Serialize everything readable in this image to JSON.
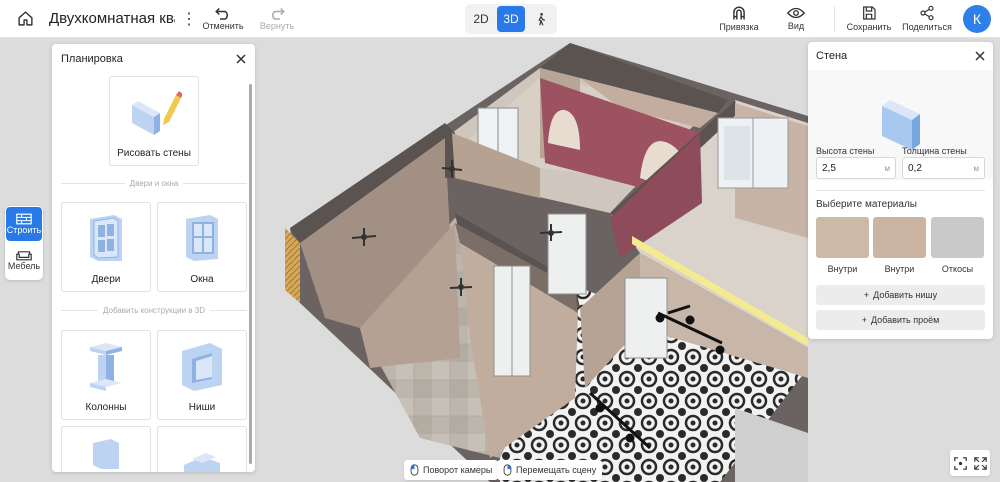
{
  "header": {
    "project_title": "Двухкомнатная квар",
    "undo_label": "Отменить",
    "redo_label": "Вернуть",
    "view_modes": [
      "2D",
      "3D"
    ],
    "active_mode": "3D",
    "snap_label": "Привязка",
    "view_label": "Вид",
    "save_label": "Сохранить",
    "share_label": "Поделиться",
    "avatar_initial": "К"
  },
  "rail": {
    "build_label": "Строить",
    "furniture_label": "Мебель"
  },
  "left_panel": {
    "title": "Планировка",
    "draw_walls_label": "Рисовать стены",
    "doors_windows_section": "Двери и окна",
    "doors_label": "Двери",
    "windows_label": "Окна",
    "constructions_section": "Добавить конструкции в 3D",
    "columns_label": "Колонны",
    "niches_label": "Ниши"
  },
  "right_panel": {
    "title": "Стена",
    "height_label": "Высота стены",
    "height_value": "2,5",
    "height_unit": "м",
    "thickness_label": "Толщина стены",
    "thickness_value": "0,2",
    "thickness_unit": "м",
    "materials_title": "Выберите материалы",
    "materials": [
      {
        "label": "Внутри",
        "color": "#cdb9a8"
      },
      {
        "label": "Внутри",
        "color": "#cbb4a1"
      },
      {
        "label": "Откосы",
        "color": "#c9c9c9"
      }
    ],
    "add_niche_label": "Добавить нишу",
    "add_opening_label": "Добавить проём"
  },
  "hints": {
    "rotate_camera": "Поворот камеры",
    "move_scene": "Перемещать сцену"
  },
  "colors": {
    "accent": "#2979e8",
    "wall": "#b8a293",
    "accent_wall": "#9c5261"
  }
}
